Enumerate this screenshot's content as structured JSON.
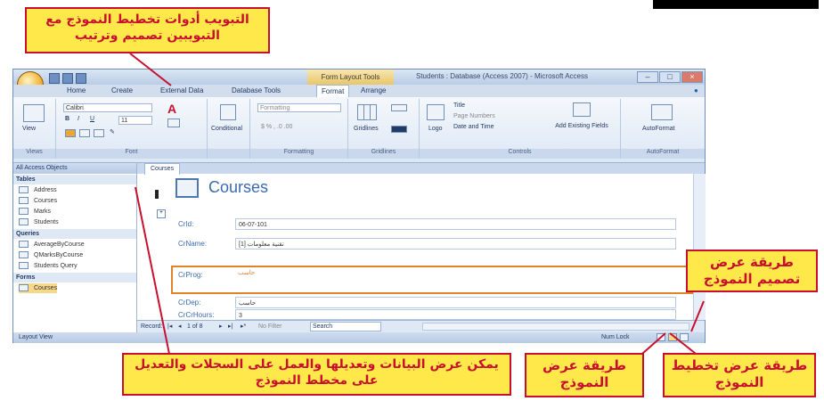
{
  "callouts": {
    "top": "التبويب أدوات تخطيط النموذج مع التبويبين تصميم وترتيب",
    "bottom_main": "يمكن عرض البيانات وتعديلها والعمل على السجلات والتعديل على مخطط النموذج",
    "form_view": "طريقة عرض النموذج",
    "layout_view": "طريقة عرض تخطيط النموذج",
    "design_view": "طريقة عرض تصميم النموذج"
  },
  "window": {
    "context_tab": "Form Layout Tools",
    "title": "Students : Database (Access 2007) - Microsoft Access",
    "tabs": [
      "Home",
      "Create",
      "External Data",
      "Database Tools",
      "Format",
      "Arrange"
    ],
    "active_tab": "Format"
  },
  "ribbon": {
    "view_label": "View",
    "font_name": "Calibri",
    "font_size": "11",
    "conditional_label": "Conditional",
    "formatting_combo": "Formatting",
    "gridlines_label": "Gridlines",
    "logo_label": "Logo",
    "title_label": "Title",
    "page_numbers_label": "Page Numbers",
    "date_time_label": "Date and Time",
    "add_fields_label": "Add Existing Fields",
    "autoformat_label": "AutoFormat",
    "groups": [
      "Views",
      "Font",
      "Formatting",
      "Gridlines",
      "Controls",
      "AutoFormat"
    ]
  },
  "nav": {
    "header": "All Access Objects",
    "sections": [
      {
        "name": "Tables",
        "items": [
          "Address",
          "Courses",
          "Marks",
          "Students"
        ]
      },
      {
        "name": "Queries",
        "items": [
          "AverageByCourse",
          "QMarksByCourse",
          "Students Query"
        ]
      },
      {
        "name": "Forms",
        "items": [
          "Courses"
        ]
      }
    ]
  },
  "document": {
    "tab_label": "Courses",
    "form_title": "Courses",
    "fields": [
      {
        "label": "CrId:",
        "value": "06-07-101"
      },
      {
        "label": "CrName:",
        "value": "تقنية معلومات [1]"
      },
      {
        "label": "CrProg:",
        "value": "حاسب"
      },
      {
        "label": "CrDep:",
        "value": "حاسب"
      },
      {
        "label": "CrCrHours:",
        "value": "3"
      }
    ],
    "record_label": "Record:",
    "record_position": "1 of 8",
    "filter_label": "No Filter",
    "search_label": "Search"
  },
  "status": {
    "left": "Layout View",
    "right": "Num Lock"
  }
}
